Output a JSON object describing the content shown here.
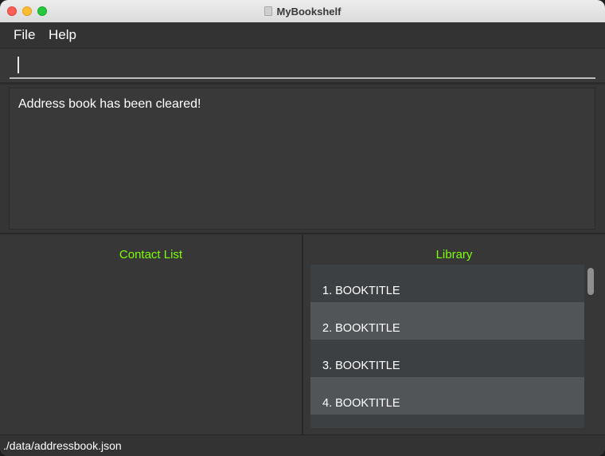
{
  "window": {
    "title": "MyBookshelf"
  },
  "menu": {
    "items": [
      "File",
      "Help"
    ]
  },
  "command_box": {
    "value": ""
  },
  "result_display": {
    "text": "Address book has been cleared!"
  },
  "contact_panel": {
    "header": "Contact List"
  },
  "library_panel": {
    "header": "Library",
    "items": [
      "1. BOOKTITLE",
      "2. BOOKTITLE",
      "3. BOOKTITLE",
      "4. BOOKTITLE"
    ]
  },
  "status_bar": {
    "path": "./data/addressbook.json"
  },
  "colors": {
    "accent_green": "#7fff00",
    "background": "#363636"
  }
}
